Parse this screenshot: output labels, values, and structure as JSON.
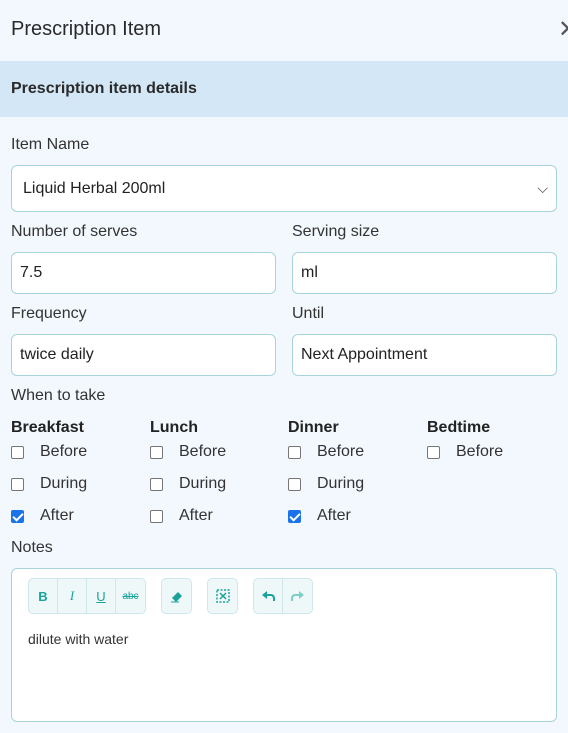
{
  "header": {
    "title": "Prescription Item",
    "close_icon": "✕"
  },
  "section": {
    "title": "Prescription item details"
  },
  "item_name": {
    "label": "Item Name",
    "value": "Liquid Herbal 200ml",
    "chevron": "⌵"
  },
  "serves": {
    "label": "Number of serves",
    "value": "7.5"
  },
  "serving_size": {
    "label": "Serving size",
    "value": "ml"
  },
  "frequency": {
    "label": "Frequency",
    "value": "twice daily"
  },
  "until": {
    "label": "Until",
    "value": "Next Appointment"
  },
  "when": {
    "label": "When to take",
    "days": [
      {
        "name": "Breakfast",
        "options": [
          {
            "label": "Before",
            "checked": false
          },
          {
            "label": "During",
            "checked": false
          },
          {
            "label": "After",
            "checked": true
          }
        ]
      },
      {
        "name": "Lunch",
        "options": [
          {
            "label": "Before",
            "checked": false
          },
          {
            "label": "During",
            "checked": false
          },
          {
            "label": "After",
            "checked": false
          }
        ]
      },
      {
        "name": "Dinner",
        "options": [
          {
            "label": "Before",
            "checked": false
          },
          {
            "label": "During",
            "checked": false
          },
          {
            "label": "After",
            "checked": true
          }
        ]
      },
      {
        "name": "Bedtime",
        "options": [
          {
            "label": "Before",
            "checked": false
          }
        ]
      }
    ]
  },
  "notes": {
    "label": "Notes",
    "text": "dilute with water",
    "toolbar": {
      "bold": "B",
      "italic": "I",
      "underline": "U",
      "strike": "abc",
      "eraser_icon": "eraser-icon",
      "fullscreen_icon": "fullscreen-icon",
      "undo_icon": "undo-icon",
      "redo_icon": "redo-icon"
    }
  },
  "colors": {
    "accent": "#1aa39a",
    "border": "#a9d3dc",
    "section_bg": "#d3e7f6",
    "page_bg": "#f2f8fd",
    "checkbox": "#1a73e8"
  }
}
